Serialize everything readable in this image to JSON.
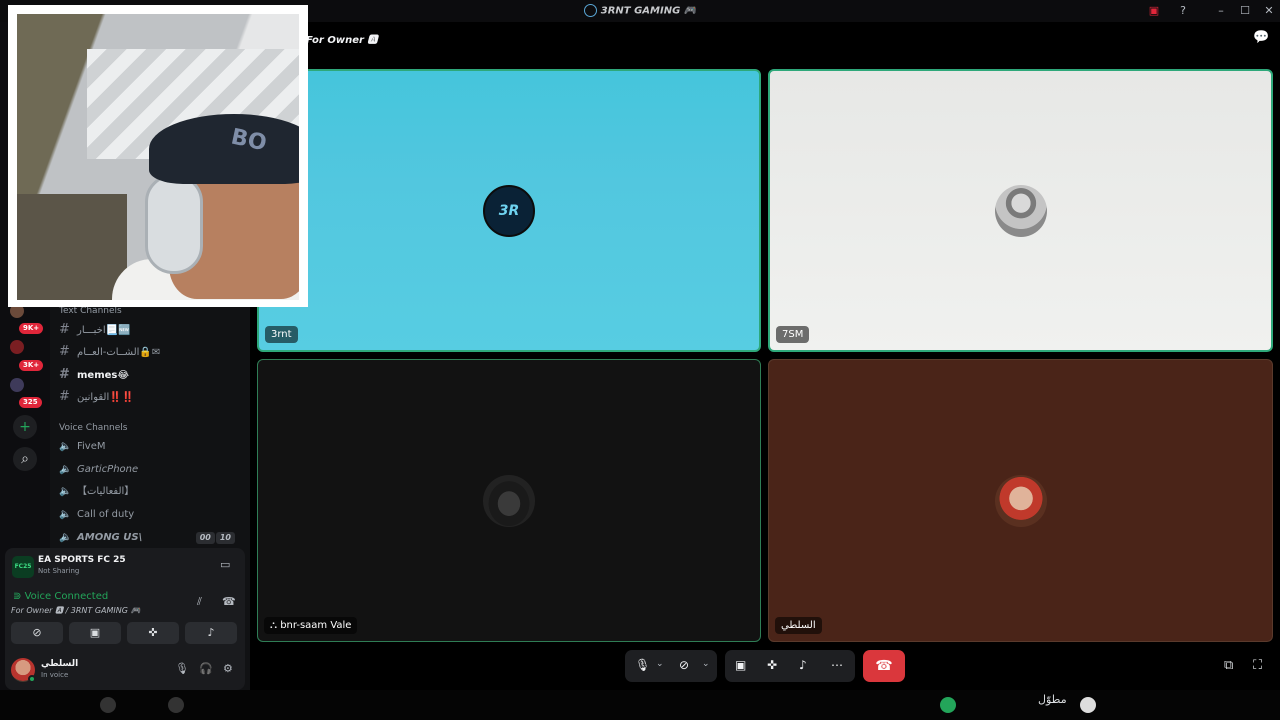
{
  "titlebar": {
    "title": "3RNT GAMING 🎮",
    "icons": [
      "cast-icon",
      "help-icon",
      "minimize-icon",
      "maximize-icon",
      "close-icon"
    ]
  },
  "rail": {
    "badges": [
      "9K+",
      "3K+",
      "325"
    ],
    "add_server": "+",
    "discover": "⌕"
  },
  "sidebar": {
    "text_category": "Text Channels",
    "text_channels": [
      "اخبـــار📃🆕",
      "الشــات-العــام🔒✉",
      "memes😂",
      "القوانين‼️‼️"
    ],
    "voice_category": "Voice Channels",
    "voice_channels": [
      "FiveM",
      "GarticPhone",
      "【الفعاليات】",
      "Call of duty",
      "AMONG US\\"
    ],
    "among_us_counts": [
      "00",
      "10"
    ]
  },
  "panel": {
    "game_name": "EA SPORTS FC 25",
    "game_status": "Not Sharing",
    "game_icon_label": "FC25",
    "voice_status": "Voice Connected",
    "voice_channel": "For Owner 🅰 / 3RNT GAMING 🎮",
    "user_name": "السلطي",
    "user_status": "In voice"
  },
  "stage": {
    "channel_title": "For Owner 🅰",
    "tiles": [
      {
        "name": "3rnt",
        "avatar_text": "3R"
      },
      {
        "name": "7SM"
      },
      {
        "name": "bnr-saam Vale",
        "prefix_icon": "playstation-icon"
      },
      {
        "name": "السلطي"
      }
    ]
  },
  "controls": {
    "mic": "microphone-icon",
    "camera": "camera-off-icon",
    "share": "screen-share-icon",
    "activity": "activity-icon",
    "soundboard": "soundboard-icon",
    "more": "more-icon",
    "hangup": "hangup-icon"
  },
  "taskbar": {
    "text": "مطوّل"
  },
  "colors": {
    "accent_green": "#23a55a",
    "hangup_red": "#da373c",
    "tile_cyan": "#52c7df",
    "tile_brown": "#4a2418"
  }
}
